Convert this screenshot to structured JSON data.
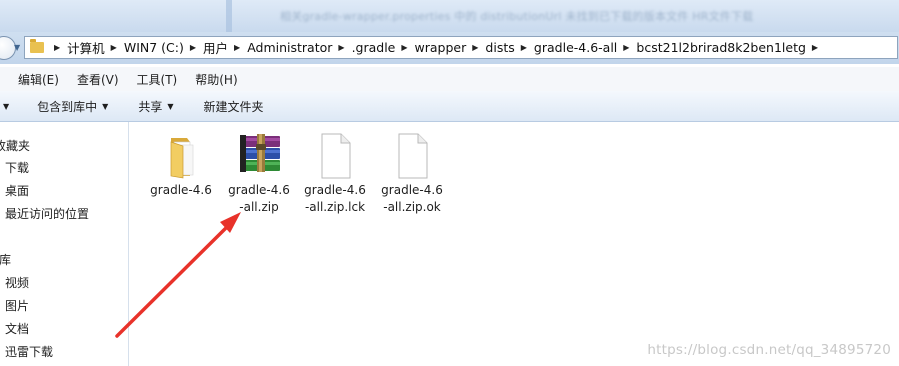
{
  "titlebar": {
    "blurred_text": "相关gradle-wrapper.properties 中的 distributionUrl  未找到已下载的版本文件  HR文件下载"
  },
  "address_bar": {
    "crumbs": [
      "计算机",
      "WIN7 (C:)",
      "用户",
      "Administrator",
      ".gradle",
      "wrapper",
      "dists",
      "gradle-4.6-all",
      "bcst21l2brirad8k2ben1letg"
    ]
  },
  "menu": {
    "items": [
      "编辑(E)",
      "查看(V)",
      "工具(T)",
      "帮助(H)"
    ]
  },
  "toolbar": {
    "include_in_library": "包含到库中",
    "share": "共享",
    "new_folder": "新建文件夹"
  },
  "nav": {
    "favorites_header": "收藏夹",
    "favorites": [
      "下载",
      "桌面",
      "最近访问的位置"
    ],
    "libraries_header": "库",
    "libraries": [
      "视频",
      "图片",
      "文档",
      "迅雷下载"
    ]
  },
  "files": [
    {
      "line1": "gradle-4.6",
      "line2": "",
      "icon": "folder-icon"
    },
    {
      "line1": "gradle-4.6",
      "line2": "-all.zip",
      "icon": "winrar-archive-icon"
    },
    {
      "line1": "gradle-4.6",
      "line2": "-all.zip.lck",
      "icon": "blank-file-icon"
    },
    {
      "line1": "gradle-4.6",
      "line2": "-all.zip.ok",
      "icon": "blank-file-icon"
    }
  ],
  "watermark": "https://blog.csdn.net/qq_34895720",
  "colors": {
    "annotation_arrow": "#e8322a",
    "window_chrome": "#c9daee",
    "folder": "#e9c150"
  }
}
